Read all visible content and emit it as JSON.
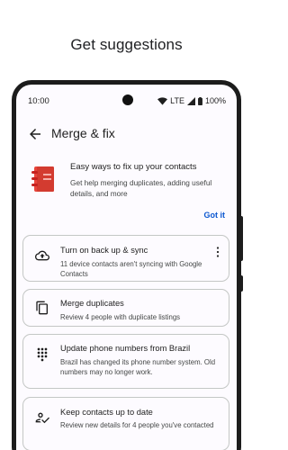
{
  "headline": "Get suggestions",
  "status_bar": {
    "time": "10:00",
    "network": "LTE",
    "battery": "100%"
  },
  "app_bar": {
    "title": "Merge & fix"
  },
  "promo": {
    "title": "Easy ways to fix up your contacts",
    "description": "Get help merging duplicates, adding useful details, and more",
    "action": "Got it"
  },
  "cards": [
    {
      "title": "Turn on back up & sync",
      "description": "11 device contacts aren't syncing with Google Contacts",
      "icon": "cloud-upload-icon"
    },
    {
      "title": "Merge duplicates",
      "description": "Review 4 people with duplicate listings",
      "icon": "copy-icon"
    },
    {
      "title": "Update phone numbers from Brazil",
      "description": "Brazil has changed its phone number system. Old numbers may no longer work.",
      "icon": "dialpad-icon"
    },
    {
      "title": "Keep contacts up to date",
      "description": "Review new details for 4 people you've contacted",
      "icon": "person-check-icon"
    }
  ],
  "colors": {
    "accent": "#0b57d0",
    "promo_red": "#e8453c",
    "background": "#fdfbff",
    "frame": "#1c1c1c"
  }
}
